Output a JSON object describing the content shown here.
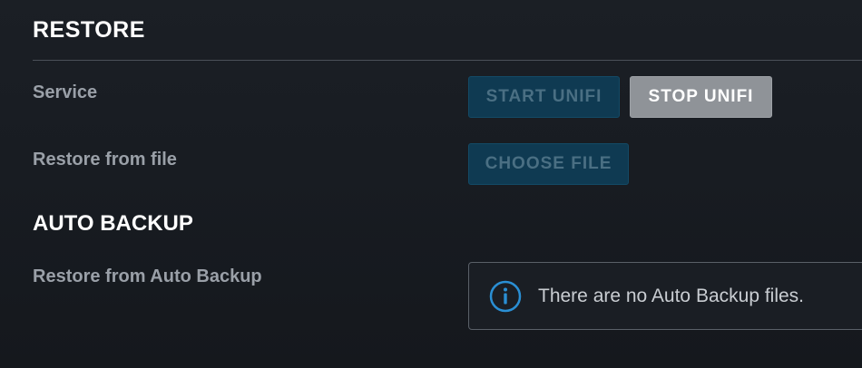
{
  "restore": {
    "title": "RESTORE",
    "service_label": "Service",
    "start_button": "START UNIFI",
    "stop_button": "STOP UNIFI",
    "file_label": "Restore from file",
    "choose_file_button": "CHOOSE FILE"
  },
  "auto_backup": {
    "title": "AUTO BACKUP",
    "label": "Restore from Auto Backup",
    "info_icon": "info-icon",
    "message": "There are no Auto Backup files."
  },
  "colors": {
    "background": "#1b1f25",
    "accent_blue": "#2a8fd4",
    "disabled_button": "#0f3a52",
    "active_button": "#8f9398"
  }
}
